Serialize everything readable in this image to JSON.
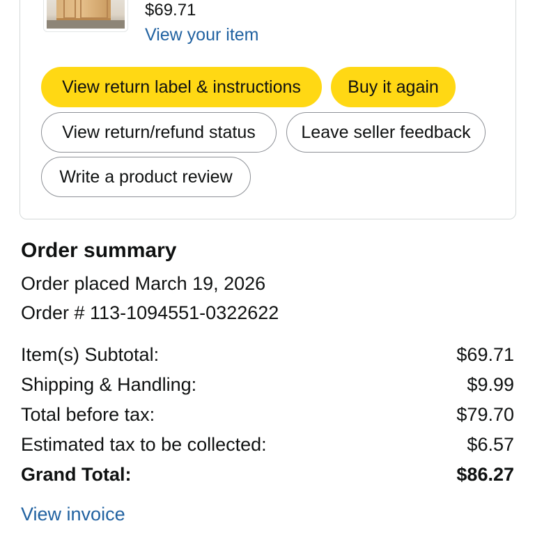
{
  "item": {
    "price": "$69.71",
    "view_link": "View your item",
    "thumbnail_icon": "product-image"
  },
  "actions": {
    "return_label": "View return label & instructions",
    "buy_again": "Buy it again",
    "refund_status": "View return/refund status",
    "seller_feedback": "Leave seller feedback",
    "product_review": "Write a product review"
  },
  "summary": {
    "title": "Order summary",
    "placed": "Order placed March 19, 2026",
    "order_number": "Order # 113-1094551-0322622",
    "rows": [
      {
        "label": "Item(s) Subtotal:",
        "value": "$69.71"
      },
      {
        "label": "Shipping & Handling:",
        "value": "$9.99"
      },
      {
        "label": "Total before tax:",
        "value": "$79.70"
      },
      {
        "label": "Estimated tax to be collected:",
        "value": "$6.57"
      }
    ],
    "grand_total": {
      "label": "Grand Total:",
      "value": "$86.27"
    },
    "invoice_link": "View invoice"
  },
  "colors": {
    "primary_button": "#ffd814",
    "link": "#2162a1",
    "text": "#0f1111",
    "border": "#d5d9d9"
  }
}
